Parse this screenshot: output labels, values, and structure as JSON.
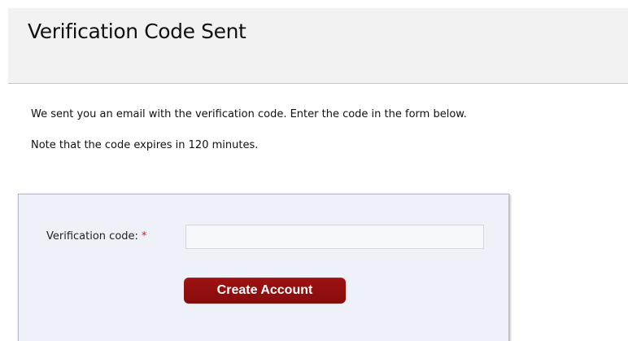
{
  "header": {
    "title": "Verification Code Sent"
  },
  "content": {
    "message_line_1": "We sent you an email with the verification code. Enter the code in the form below.",
    "message_line_2": "Note that the code expires in 120 minutes."
  },
  "form": {
    "code_label": "Verification code:",
    "required_marker": "*",
    "code_value": "",
    "code_placeholder": "",
    "submit_label": "Create Account"
  },
  "colors": {
    "header_background": "#f2f2f2",
    "panel_background": "#eef1f7",
    "button_background": "#910f0f",
    "required_marker": "#d0261c"
  }
}
